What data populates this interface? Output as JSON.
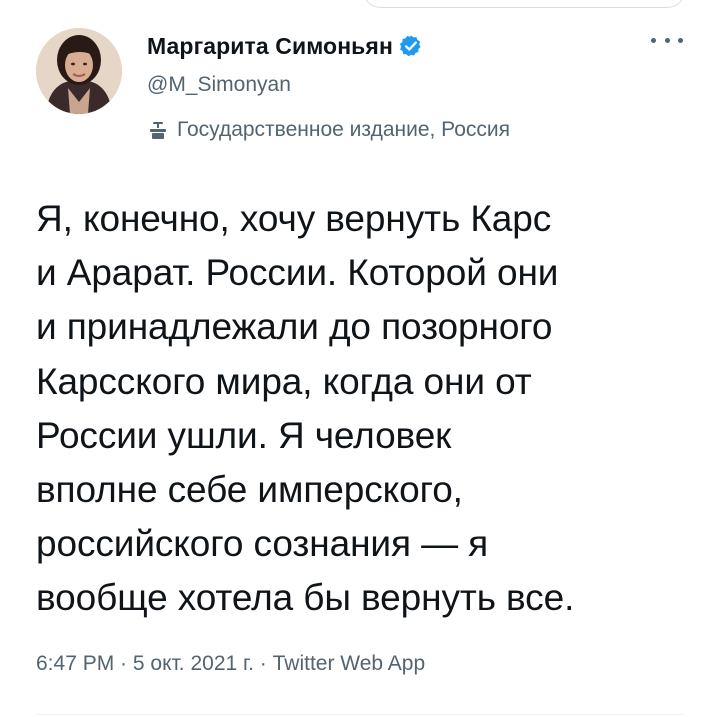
{
  "author": {
    "display_name": "Маргарита Симоньян",
    "handle": "@M_Simonyan",
    "verified": true,
    "state_label": "Государственное издание, Россия"
  },
  "tweet": {
    "text": "Я, конечно, хочу вернуть Карс\nи Арарат. России. Которой они\nи принадлежали до позорного\nКарсского мира, когда они от\nРоссии ушли. Я человек\nвполне себе имперского,\nроссийского сознания — я\nвообще хотела бы вернуть все.",
    "time": "6:47 PM",
    "date": "5 окт. 2021 г.",
    "source": "Twitter Web App",
    "separator": " · "
  },
  "icons": {
    "verified": "verified-badge-icon",
    "more": "more-options-icon",
    "state_media": "podium-icon",
    "avatar": "profile-photo"
  },
  "colors": {
    "verified_blue": "#1d9bf0",
    "secondary_text": "#536471",
    "primary_text": "#0f1419"
  }
}
